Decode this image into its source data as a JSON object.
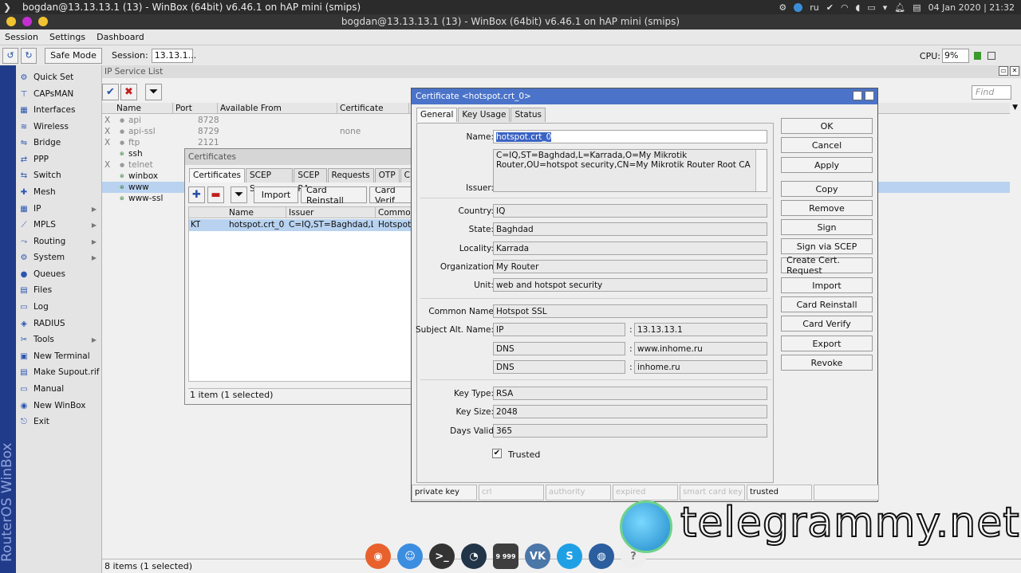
{
  "sysbar": {
    "title": "bogdan@13.13.13.1 (13) - WinBox (64bit) v6.46.1 on hAP mini (smips)",
    "lang": "ru",
    "date": "04 Jan 2020 | 21:32"
  },
  "window": {
    "title": "bogdan@13.13.13.1 (13) - WinBox (64bit) v6.46.1 on hAP mini (smips)"
  },
  "menu": [
    "Session",
    "Settings",
    "Dashboard"
  ],
  "toolbar": {
    "safe_mode": "Safe Mode",
    "session_label": "Session:",
    "session_value": "13.13.1...",
    "cpu_label": "CPU:",
    "cpu_value": "9%"
  },
  "brand_vertical": "RouterOS WinBox",
  "sidebar": [
    {
      "label": "Quick Set",
      "icon": "quick-set-icon"
    },
    {
      "label": "CAPsMAN",
      "icon": "capsman-icon"
    },
    {
      "label": "Interfaces",
      "icon": "interfaces-icon"
    },
    {
      "label": "Wireless",
      "icon": "wireless-icon"
    },
    {
      "label": "Bridge",
      "icon": "bridge-icon"
    },
    {
      "label": "PPP",
      "icon": "ppp-icon"
    },
    {
      "label": "Switch",
      "icon": "switch-icon"
    },
    {
      "label": "Mesh",
      "icon": "mesh-icon"
    },
    {
      "label": "IP",
      "icon": "ip-icon",
      "submenu": true
    },
    {
      "label": "MPLS",
      "icon": "mpls-icon",
      "submenu": true
    },
    {
      "label": "Routing",
      "icon": "routing-icon",
      "submenu": true
    },
    {
      "label": "System",
      "icon": "system-icon",
      "submenu": true
    },
    {
      "label": "Queues",
      "icon": "queues-icon"
    },
    {
      "label": "Files",
      "icon": "files-icon"
    },
    {
      "label": "Log",
      "icon": "log-icon"
    },
    {
      "label": "RADIUS",
      "icon": "radius-icon"
    },
    {
      "label": "Tools",
      "icon": "tools-icon",
      "submenu": true
    },
    {
      "label": "New Terminal",
      "icon": "terminal-icon"
    },
    {
      "label": "Make Supout.rif",
      "icon": "supout-icon"
    },
    {
      "label": "Manual",
      "icon": "manual-icon"
    },
    {
      "label": "New WinBox",
      "icon": "winbox-icon"
    },
    {
      "label": "Exit",
      "icon": "exit-icon"
    }
  ],
  "ip_service_list": {
    "title": "IP Service List",
    "find_placeholder": "Find",
    "columns": [
      "Name",
      "Port",
      "Available From",
      "Certificate"
    ],
    "rows": [
      {
        "flag": "X",
        "name": "api",
        "port": "8728",
        "from": "",
        "cert": ""
      },
      {
        "flag": "X",
        "name": "api-ssl",
        "port": "8729",
        "from": "",
        "cert": "none"
      },
      {
        "flag": "X",
        "name": "ftp",
        "port": "2121",
        "from": "",
        "cert": ""
      },
      {
        "flag": "",
        "name": "ssh",
        "port": "",
        "from": "",
        "cert": ""
      },
      {
        "flag": "X",
        "name": "telnet",
        "port": "",
        "from": "",
        "cert": ""
      },
      {
        "flag": "",
        "name": "winbox",
        "port": "",
        "from": "",
        "cert": ""
      },
      {
        "flag": "",
        "name": "www",
        "port": "",
        "from": "",
        "cert": "",
        "selected": true
      },
      {
        "flag": "",
        "name": "www-ssl",
        "port": "",
        "from": "",
        "cert": ""
      }
    ],
    "status": "8 items (1 selected)"
  },
  "certificates": {
    "title": "Certificates",
    "tabs": [
      "Certificates",
      "SCEP Servers",
      "SCEP RA",
      "Requests",
      "OTP",
      "C"
    ],
    "buttons": [
      "Import",
      "Card Reinstall",
      "Card Verif"
    ],
    "columns": [
      "Name",
      "Issuer",
      "Common"
    ],
    "row": {
      "flags": "KT",
      "name": "hotspot.crt_0",
      "issuer": "C=IQ,ST=Baghdad,L...",
      "common": "Hotspot"
    },
    "status": "1 item (1 selected)"
  },
  "cert_dialog": {
    "title": "Certificate <hotspot.crt_0>",
    "tabs": [
      "General",
      "Key Usage",
      "Status"
    ],
    "labels": {
      "name": "Name:",
      "issuer": "Issuer:",
      "country": "Country:",
      "state": "State:",
      "locality": "Locality:",
      "organization": "Organization",
      "unit": "Unit:",
      "common_name": "Common Name",
      "san": "Subject Alt. Name:",
      "key_type": "Key Type:",
      "key_size": "Key Size:",
      "days_valid": "Days Valid",
      "trusted": "Trusted"
    },
    "values": {
      "name": "hotspot.crt_0",
      "issuer": "C=IQ,ST=Baghdad,L=Karrada,O=My Mikrotik Router,OU=hotspot security,CN=My Mikrotik Router Root CA",
      "country": "IQ",
      "state": "Baghdad",
      "locality": "Karrada",
      "organization": "My Router",
      "unit": "web and hotspot security",
      "common_name": "Hotspot SSL",
      "san": [
        {
          "type": "IP",
          "value": "13.13.13.1"
        },
        {
          "type": "DNS",
          "value": "www.inhome.ru"
        },
        {
          "type": "DNS",
          "value": "inhome.ru"
        }
      ],
      "key_type": "RSA",
      "key_size": "2048",
      "days_valid": "365"
    },
    "buttons": [
      "OK",
      "Cancel",
      "Apply",
      "Copy",
      "Remove",
      "Sign",
      "Sign via SCEP",
      "Create Cert. Request",
      "Import",
      "Card Reinstall",
      "Card Verify",
      "Export",
      "Revoke"
    ],
    "statusbar": [
      "private key",
      "crl",
      "authority",
      "expired",
      "smart card key",
      "trusted",
      ""
    ]
  },
  "dock": {
    "badge": "9 999"
  },
  "watermark": "telegrammy.net",
  "colors": {
    "dialog_title": "#4a73c9",
    "selection": "#b8d2f0",
    "strip": "#203b8a"
  }
}
